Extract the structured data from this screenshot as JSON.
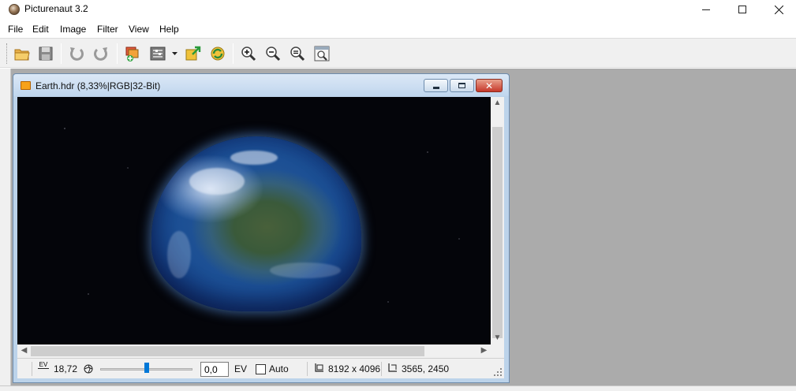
{
  "window": {
    "title": "Picturenaut 3.2"
  },
  "menu": {
    "items": [
      "File",
      "Edit",
      "Image",
      "Filter",
      "View",
      "Help"
    ]
  },
  "toolbar": {
    "buttons": [
      "open-folder-icon",
      "save-icon",
      "undo-icon",
      "redo-icon",
      "generate-hdr-icon",
      "settings-icon",
      "tonemap-icon",
      "refresh-icon",
      "zoom-in-icon",
      "zoom-out-icon",
      "zoom-fit-icon",
      "zoom-window-icon"
    ]
  },
  "document": {
    "title": "Earth.hdr (8,33%|RGB|32-Bit)",
    "close_glyph": "✕"
  },
  "statusbar": {
    "ev_icon_label": "EV",
    "ev_value": "18,72",
    "exposure_value": "0,0",
    "exposure_unit": "EV",
    "exposure_slider_fraction": 0.5,
    "auto_label": "Auto",
    "auto_checked": false,
    "dimensions": "8192 x 4096",
    "cursor_position": "3565, 2450"
  },
  "colors": {
    "accent": "#0078d7",
    "child_frame": "#bcd3ea",
    "close_red": "#c6382a",
    "mdi_background": "#ababab"
  }
}
